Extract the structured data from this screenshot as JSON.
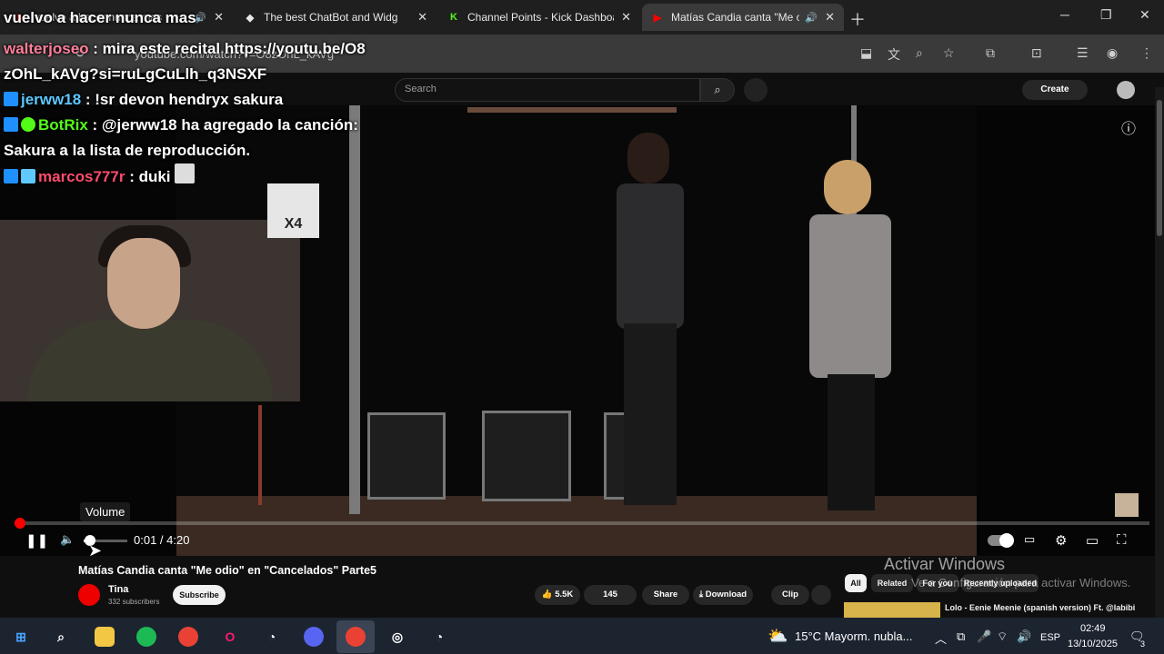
{
  "browser": {
    "tabs": [
      {
        "title": "vuelvo a hacer nunca mas",
        "favicon": "youtube-icon",
        "color": "#ff0000"
      },
      {
        "title": "The best ChatBot and Widg",
        "favicon": "chatbot-icon",
        "color": "#ffffff"
      },
      {
        "title": "Channel Points - Kick Dashboar",
        "favicon": "kick-icon",
        "color": "#53fc18"
      },
      {
        "title": "Matías Candia canta \"Me o",
        "favicon": "youtube-icon",
        "color": "#ff0000"
      }
    ],
    "url": "youtube.com/watch?v=O8zOhL_kAVg"
  },
  "youtube": {
    "search_placeholder": "Search",
    "create_label": "Create",
    "volume_tooltip": "Volume",
    "time_current": "0:01",
    "time_separator": " / ",
    "time_total": "4:20",
    "progress": 0.004,
    "volume": 0.15,
    "video_title": "Matías Candia canta \"Me odio\" en \"Cancelados\" Parte5",
    "channel_name": "Tina",
    "channel_subs": "332 subscribers",
    "subscribe_label": "Subscribe",
    "likes": "5.5K",
    "dislikes": "145",
    "share_label": "Share",
    "download_label": "Download",
    "clip_label": "Clip",
    "chips": [
      "All",
      "Related",
      "For you",
      "Recently uploaded"
    ],
    "rec_title": "Lolo - Eenie Meenie (spanish version) Ft. @labibi"
  },
  "overlay": {
    "heading": "vuelvo a hacer nunca mas",
    "chat": [
      {
        "user": "walterjoseo",
        "user_color": "#ff7f9a",
        "message": " : mira este recital https://youtu.be/O8zOhL_kAVg?si=ruLgCuLlh_q3NSXF"
      },
      {
        "user": "jerww18",
        "user_color": "#5ec8ff",
        "message": " : !sr devon hendryx sakura"
      },
      {
        "user": "BotRix",
        "user_color": "#53fc18",
        "message": " : @jerww18 ha agregado la canción: Sakura a la lista de reproducción."
      },
      {
        "user": "marcos777r",
        "user_color": "#ff4d6d",
        "message": " : duki"
      }
    ],
    "emote_text": "X4"
  },
  "windows": {
    "watermark_title": "Activar Windows",
    "watermark_sub": "Ve a Configuración para activar Windows.",
    "weather": "15°C  Mayorm. nubla...",
    "lang": "ESP",
    "time": "02:49",
    "date": "13/10/2025",
    "notifications": "3"
  }
}
